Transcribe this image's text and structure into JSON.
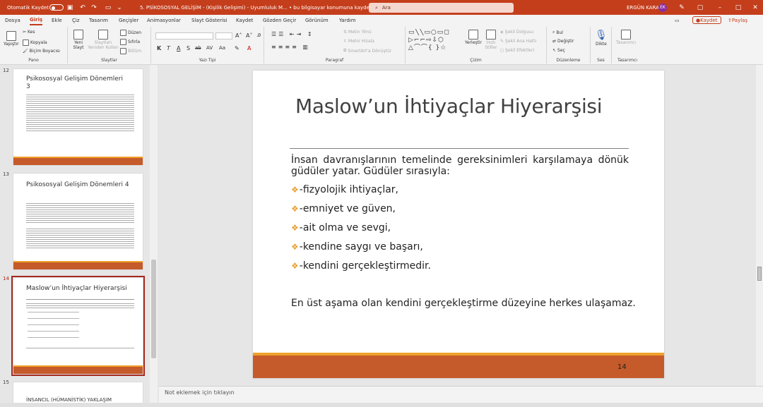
{
  "titlebar": {
    "autosave_label": "Otomatik Kaydet",
    "document_title": "5. PSİKOSOSYAL GELİŞİM - (Kişilik Gelişimi)  -  Uyumluluk M...  •  bu bilgisayar konumuna kaydedildi",
    "search_placeholder": "Ara",
    "user_name": "ERGÜN KARA",
    "user_initials": "EK"
  },
  "tabs": {
    "items": [
      "Dosya",
      "Giriş",
      "Ekle",
      "Çiz",
      "Tasarım",
      "Geçişler",
      "Animasyonlar",
      "Slayt Gösterisi",
      "Kaydet",
      "Gözden Geçir",
      "Görünüm",
      "Yardım"
    ],
    "active": "Giriş",
    "save_label": "Kaydet",
    "share_label": "Paylaş"
  },
  "ribbon": {
    "pano": {
      "label": "Pano",
      "paste": "Yapıştır",
      "cut": "Kes",
      "copy": "Kopyala",
      "format_painter": "Biçim Boyacısı"
    },
    "slaytlar": {
      "label": "Slaytlar",
      "new_slide": "Yeni Slayt",
      "reuse": "Slaytları Yeniden Kullan",
      "layout": "Düzen",
      "reset": "Sıfırla",
      "section": "Bölüm"
    },
    "yazi_tipi": {
      "label": "Yazı Tipi"
    },
    "paragraf": {
      "label": "Paragraf",
      "text_direction": "Metin Yönü",
      "align_text": "Metni Hizala",
      "smartart": "SmartArt'a Dönüştür"
    },
    "cizim": {
      "label": "Çizim",
      "arrange": "Yerleştir",
      "quick_styles": "Hızlı Stiller",
      "shape_fill": "Şekil Dolgusu",
      "shape_outline": "Şekil Ana Hattı",
      "shape_effects": "Şekil Efektleri"
    },
    "duzenleme": {
      "label": "Düzenleme",
      "find": "Bul",
      "replace": "Değiştir",
      "select": "Seç"
    },
    "ses": {
      "label": "Ses",
      "dictate": "Dikte"
    },
    "tasarimci": {
      "label": "Tasarımcı",
      "designer": "Tasarımcı"
    }
  },
  "thumbnails": [
    {
      "number": "12",
      "title": "Psikososyal Gelişim Dönemleri 3"
    },
    {
      "number": "13",
      "title": "Psikososyal Gelişim Dönemleri 4"
    },
    {
      "number": "14",
      "title": "Maslow’un İhtiyaçlar Hiyerarşisi"
    },
    {
      "number": "15",
      "title": "İNSANCIL (HÜMANİSTİK) YAKLAŞIM"
    }
  ],
  "slide": {
    "title": "Maslow’un İhtiyaçlar Hiyerarşisi",
    "intro": "İnsan davranışlarının temelinde gereksinimleri karşılamaya dönük güdüler yatar. Güdüler sırasıyla:",
    "bullets": [
      "-fizyolojik ihtiyaçlar,",
      "-emniyet ve güven,",
      "-ait olma ve sevgi,",
      "-kendine saygı ve başarı,",
      "-kendini gerçekleştirmedir."
    ],
    "footer_text": "En üst aşama olan kendini gerçekleştirme düzeyine herkes ulaşamaz.",
    "page_number": "14"
  },
  "notes_placeholder": "Not eklemek için tıklayın",
  "colors": {
    "accent": "#c43e1c",
    "band_orange": "#f0a12a",
    "band_rust": "#c55a2a",
    "bullet": "#e8a33a"
  }
}
